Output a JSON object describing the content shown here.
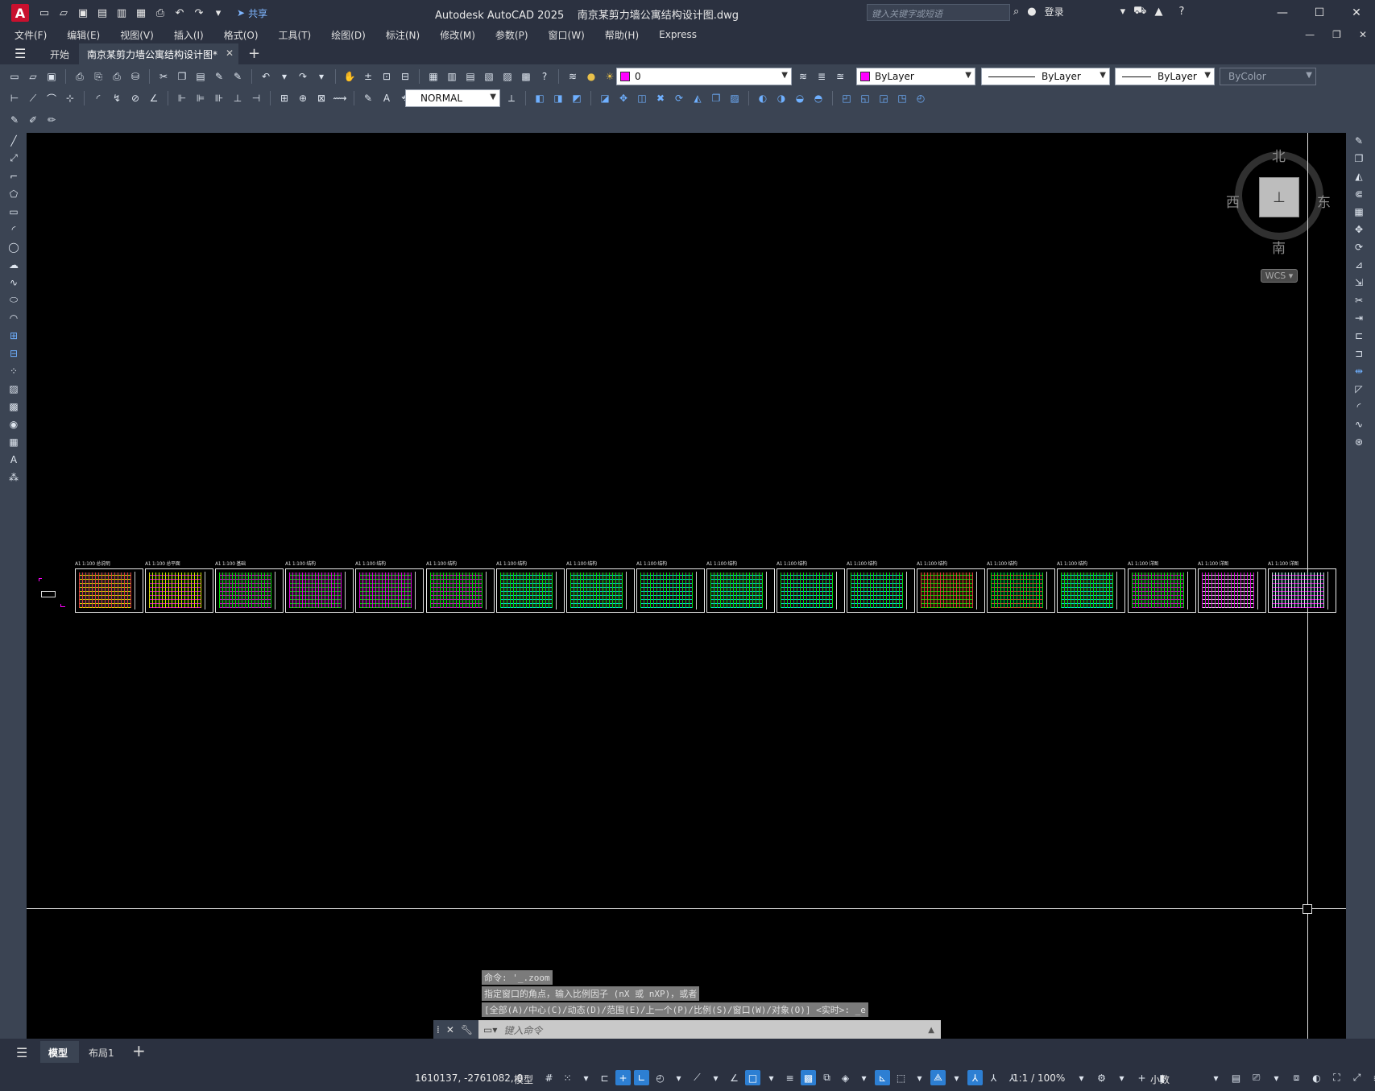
{
  "titlebar": {
    "app": "Autodesk AutoCAD 2025",
    "file": "南京某剪力墙公寓结构设计图.dwg",
    "share": "共享",
    "search_placeholder": "键入关键字或短语",
    "login": "登录"
  },
  "menu": [
    "文件(F)",
    "编辑(E)",
    "视图(V)",
    "插入(I)",
    "格式(O)",
    "工具(T)",
    "绘图(D)",
    "标注(N)",
    "修改(M)",
    "参数(P)",
    "窗口(W)",
    "帮助(H)",
    "Express"
  ],
  "tabs": {
    "start": "开始",
    "document": "南京某剪力墙公寓结构设计图*"
  },
  "properties": {
    "layer": "0",
    "color": "ByLayer",
    "linetype": "ByLayer",
    "lineweight": "ByLayer",
    "plotstyle": "ByColor",
    "textstyle": "NORMAL",
    "color_swatch": "#ff00ff"
  },
  "compass": {
    "north": "北",
    "south": "南",
    "east": "东",
    "west": "西",
    "ucs": "WCS"
  },
  "sheets": [
    {
      "label": "A1 1:100 总说明"
    },
    {
      "label": "A1 1:100 总平面"
    },
    {
      "label": "A1 1:100 基础"
    },
    {
      "label": "A1 1:100 结构"
    },
    {
      "label": "A1 1:100 结构"
    },
    {
      "label": "A1 1:100 结构"
    },
    {
      "label": "A1 1:100 结构"
    },
    {
      "label": "A1 1:100 结构"
    },
    {
      "label": "A1 1:100 结构"
    },
    {
      "label": "A1 1:100 结构"
    },
    {
      "label": "A1 1:100 结构"
    },
    {
      "label": "A1 1:100 结构"
    },
    {
      "label": "A1 1:100 结构"
    },
    {
      "label": "A1 1:100 结构"
    },
    {
      "label": "A1 1:100 结构"
    },
    {
      "label": "A1 1:100 详图"
    },
    {
      "label": "A1 1:100 详图"
    },
    {
      "label": "A1 1:100 详图"
    }
  ],
  "command": {
    "history": [
      "命令: '_.zoom",
      "指定窗口的角点，输入比例因子 (nX 或 nXP)，或者",
      "[全部(A)/中心(C)/动态(D)/范围(E)/上一个(P)/比例(S)/窗口(W)/对象(O)] <实时>: _e"
    ],
    "placeholder": "键入命令"
  },
  "layout_tabs": {
    "model": "模型",
    "layout1": "布局1"
  },
  "status": {
    "coords": "1610137, -2761082, 0",
    "model": "模型",
    "scale": "1:1 / 100%",
    "units": "小数"
  }
}
